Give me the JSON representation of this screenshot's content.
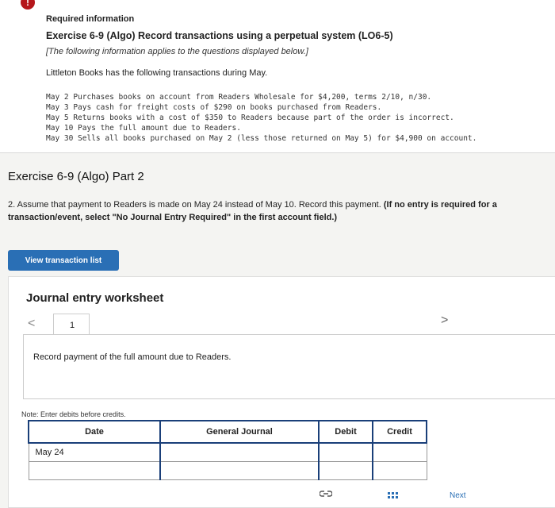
{
  "info": {
    "alert_icon": "!",
    "required": "Required information",
    "exercise_title": "Exercise 6-9 (Algo) Record transactions using a perpetual system (LO6-5)",
    "note": "[The following information applies to the questions displayed below.]",
    "intro": "Littleton Books has the following transactions during May.",
    "transactions": [
      "May 2 Purchases books on account from Readers Wholesale for $4,200, terms 2/10, n/30.",
      "May 3 Pays cash for freight costs of $290 on books purchased from Readers.",
      "May 5 Returns books with a cost of $350 to Readers because part of the order is incorrect.",
      "May 10 Pays the full amount due to Readers.",
      "May 30 Sells all books purchased on May 2 (less those returned on May 5) for $4,900 on account."
    ]
  },
  "part_title": "Exercise 6-9 (Algo) Part 2",
  "question": {
    "text": "2. Assume that payment to Readers is made on May 24 instead of May 10. Record this payment. ",
    "bold": "(If no entry is required for a transaction/event, select \"No Journal Entry Required\" in the first account field.)"
  },
  "view_button": "View transaction list",
  "worksheet": {
    "title": "Journal entry worksheet",
    "prev": "<",
    "next": ">",
    "page": "1",
    "description": "Record payment of the full amount due to Readers.",
    "note": "Note: Enter debits before credits.",
    "columns": [
      "Date",
      "General Journal",
      "Debit",
      "Credit"
    ],
    "rows": [
      [
        "May 24",
        "",
        "",
        ""
      ],
      [
        "",
        "",
        "",
        ""
      ]
    ]
  },
  "footer": {
    "next_label": "Next"
  }
}
